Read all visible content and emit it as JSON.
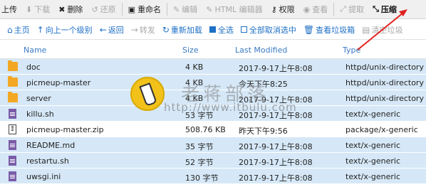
{
  "toolbar1": {
    "upload": "上传",
    "download": "下载",
    "delete": "删除",
    "restore": "还原",
    "rename": "重命名",
    "edit": "编辑",
    "html_editor": "HTML 编辑器",
    "permissions": "权限",
    "view": "查看",
    "extract": "提取",
    "compress": "压缩"
  },
  "toolbar2": {
    "home": "主页",
    "up_level": "向上一个级别",
    "back": "返回",
    "forward": "转发",
    "reload": "重新加载",
    "select_all": "全选",
    "deselect_all": "全部取消选中",
    "view_trash": "查看垃圾箱",
    "empty_trash": "清空垃圾"
  },
  "columns": {
    "name": "Name",
    "size": "Size",
    "modified": "Last Modified",
    "type": "Type"
  },
  "files": [
    {
      "icon": "folder-icon",
      "name": "doc",
      "size": "4 KB",
      "modified": "2017-9-17上午8:08",
      "type": "httpd/unix-directory",
      "selected": true
    },
    {
      "icon": "folder-icon",
      "name": "picmeup-master",
      "size": "4 KB",
      "modified": "今天下午8:25",
      "type": "httpd/unix-directory",
      "selected": true
    },
    {
      "icon": "folder-icon",
      "name": "server",
      "size": "4 KB",
      "modified": "2017-9-17上午8:08",
      "type": "httpd/unix-directory",
      "selected": true
    },
    {
      "icon": "text-file-icon",
      "name": "killu.sh",
      "size": "53 字节",
      "modified": "2017-9-17上午8:08",
      "type": "text/x-generic",
      "selected": true
    },
    {
      "icon": "zip-file-icon",
      "name": "picmeup-master.zip",
      "size": "508.76 KB",
      "modified": "昨天下午9:56",
      "type": "package/x-generic",
      "selected": false
    },
    {
      "icon": "text-file-icon",
      "name": "README.md",
      "size": "35 字节",
      "modified": "2017-9-17上午8:08",
      "type": "text/x-generic",
      "selected": true
    },
    {
      "icon": "text-file-icon",
      "name": "restartu.sh",
      "size": "52 字节",
      "modified": "2017-9-17上午8:08",
      "type": "text/x-generic",
      "selected": true
    },
    {
      "icon": "text-file-icon",
      "name": "uwsgi.ini",
      "size": "130 字节",
      "modified": "2017-9-17上午8:08",
      "type": "text/x-generic",
      "selected": true
    }
  ],
  "watermark": {
    "title": "老蒋部落",
    "url": "http://www.itbulu.com"
  },
  "colors": {
    "selected_row": "#d6e8f7",
    "link_blue": "#1e6fc5",
    "arrow_red": "#e02020",
    "folder": "#f3a824"
  }
}
